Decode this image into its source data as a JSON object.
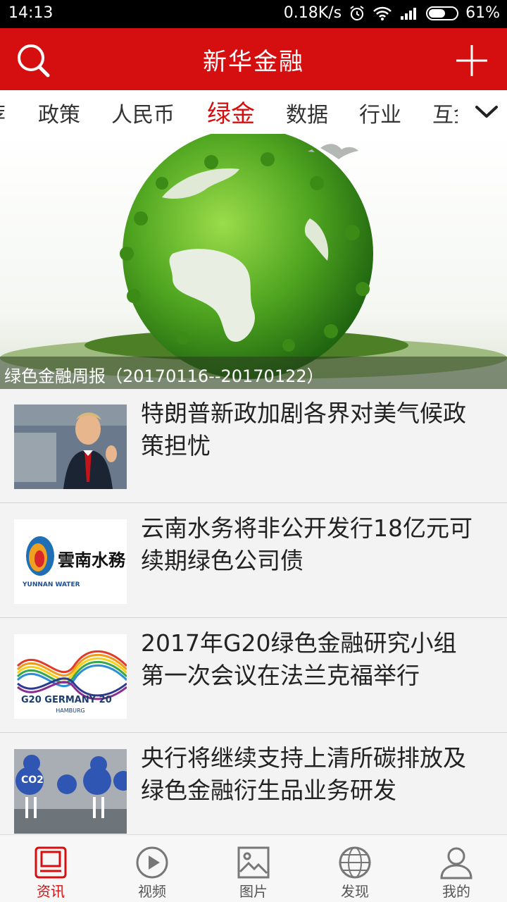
{
  "status_bar": {
    "time": "14:13",
    "network_speed": "0.18K/s",
    "battery": "61%",
    "battery_level": 0.61
  },
  "header": {
    "title": "新华金融",
    "search_icon": "search-icon",
    "add_icon": "plus-icon",
    "color": "#d50f0f"
  },
  "tabs": {
    "items": [
      "荐",
      "政策",
      "人民币",
      "绿金",
      "数据",
      "行业",
      "互金"
    ],
    "active": "绿金",
    "more_icon": "chevron-down-icon"
  },
  "banner": {
    "caption": "绿色金融周报（20170116--20170122）"
  },
  "news": [
    {
      "title": "特朗普新政加剧各界对美气候政策担忧"
    },
    {
      "title": "云南水务将非公开发行18亿元可续期绿色公司债",
      "thumb_text": "雲南水務",
      "thumb_subtext": "YUNNAN WATER"
    },
    {
      "title": "2017年G20绿色金融研究小组第一次会议在法兰克福举行",
      "thumb_text": "G20 GERMANY 20",
      "thumb_subtext": "HAMBURG"
    },
    {
      "title": "央行将继续支持上清所碳排放及绿色金融衍生品业务研发",
      "thumb_text": "CO2"
    }
  ],
  "bottom_nav": {
    "items": [
      {
        "label": "资讯",
        "icon": "news-icon"
      },
      {
        "label": "视频",
        "icon": "play-icon"
      },
      {
        "label": "图片",
        "icon": "image-icon"
      },
      {
        "label": "发现",
        "icon": "globe-icon"
      },
      {
        "label": "我的",
        "icon": "user-icon"
      }
    ],
    "active": "资讯",
    "active_color": "#d50f0f"
  }
}
